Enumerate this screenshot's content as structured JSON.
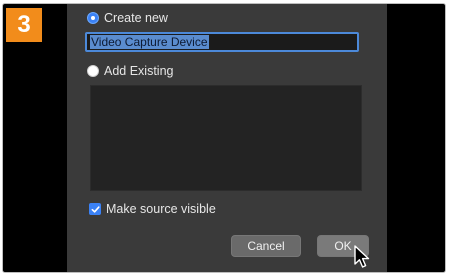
{
  "step_badge": "3",
  "dialog": {
    "create_new_label": "Create new",
    "source_name_value": "Video Capture Device",
    "add_existing_label": "Add Existing",
    "make_visible_label": "Make source visible",
    "make_visible_checked": true,
    "selected_option": "Create new",
    "cancel_label": "Cancel",
    "ok_label": "OK"
  },
  "colors": {
    "badge": "#f28c1b",
    "dialog_bg": "#3a3a3a",
    "accent": "#3b82f6"
  },
  "icons": {
    "cursor": "mouse-pointer-icon",
    "check": "checkmark-icon"
  }
}
